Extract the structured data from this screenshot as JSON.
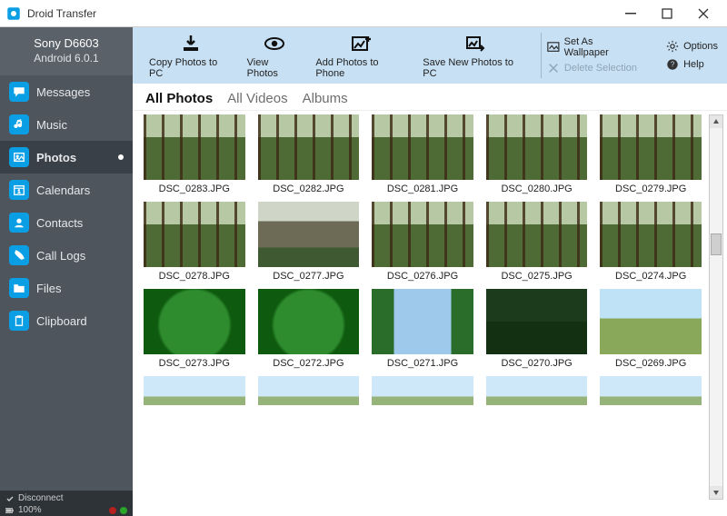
{
  "app": {
    "title": "Droid Transfer"
  },
  "window_controls": {
    "min": "minimize-icon",
    "max": "maximize-icon",
    "close": "close-icon"
  },
  "device": {
    "name": "Sony D6603",
    "os": "Android 6.0.1"
  },
  "sidebar": {
    "items": [
      {
        "label": "Messages",
        "icon": "chat-icon"
      },
      {
        "label": "Music",
        "icon": "music-icon"
      },
      {
        "label": "Photos",
        "icon": "photo-icon"
      },
      {
        "label": "Calendars",
        "icon": "calendar-icon"
      },
      {
        "label": "Contacts",
        "icon": "contacts-icon"
      },
      {
        "label": "Call Logs",
        "icon": "phone-icon"
      },
      {
        "label": "Files",
        "icon": "folder-icon"
      },
      {
        "label": "Clipboard",
        "icon": "clipboard-icon"
      }
    ],
    "active_index": 2
  },
  "status": {
    "disconnect": "Disconnect",
    "battery": "100%"
  },
  "toolbar": {
    "buttons": [
      {
        "label": "Copy Photos to PC",
        "icon": "download-icon"
      },
      {
        "label": "View Photos",
        "icon": "eye-icon"
      },
      {
        "label": "Add Photos to Phone",
        "icon": "add-photo-icon"
      },
      {
        "label": "Save New Photos to PC",
        "icon": "save-new-icon"
      }
    ],
    "side": {
      "wallpaper": "Set As Wallpaper",
      "delete": "Delete Selection",
      "options": "Options",
      "help": "Help"
    }
  },
  "tabs": {
    "items": [
      "All Photos",
      "All Videos",
      "Albums"
    ],
    "active_index": 0
  },
  "photos": {
    "rows": [
      [
        {
          "name": "DSC_0283.JPG",
          "style": "trees"
        },
        {
          "name": "DSC_0282.JPG",
          "style": "trees"
        },
        {
          "name": "DSC_0281.JPG",
          "style": "trees"
        },
        {
          "name": "DSC_0280.JPG",
          "style": "trees"
        },
        {
          "name": "DSC_0279.JPG",
          "style": "trees"
        }
      ],
      [
        {
          "name": "DSC_0278.JPG",
          "style": "trees"
        },
        {
          "name": "DSC_0277.JPG",
          "style": "deer"
        },
        {
          "name": "DSC_0276.JPG",
          "style": "trees"
        },
        {
          "name": "DSC_0275.JPG",
          "style": "trees"
        },
        {
          "name": "DSC_0274.JPG",
          "style": "trees"
        }
      ],
      [
        {
          "name": "DSC_0273.JPG",
          "style": "leaf"
        },
        {
          "name": "DSC_0272.JPG",
          "style": "leaf"
        },
        {
          "name": "DSC_0271.JPG",
          "style": "blue"
        },
        {
          "name": "DSC_0270.JPG",
          "style": "dk"
        },
        {
          "name": "DSC_0269.JPG",
          "style": "field"
        }
      ],
      [
        {
          "name": "",
          "style": "sky cut"
        },
        {
          "name": "",
          "style": "sky cut"
        },
        {
          "name": "",
          "style": "sky cut"
        },
        {
          "name": "",
          "style": "sky cut"
        },
        {
          "name": "",
          "style": "sky cut"
        }
      ]
    ]
  },
  "colors": {
    "accent": "#0a9fe5",
    "toolbar_bg": "#c7e0f3",
    "sidebar_bg": "#4e555d"
  }
}
